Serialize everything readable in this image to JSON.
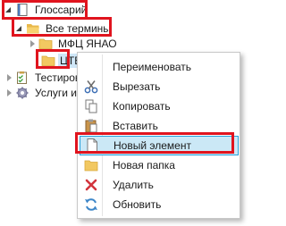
{
  "tree": {
    "root": {
      "label": "Глоссарий",
      "icon": "book-icon"
    },
    "all_terms": {
      "label": "Все термины",
      "icon": "open-folder-icon"
    },
    "children": [
      {
        "label": "МФЦ ЯНАО",
        "icon": "folder-icon"
      },
      {
        "label": "ЦТБ",
        "icon": "folder-icon"
      }
    ],
    "siblings": [
      {
        "label": "Тестиров",
        "icon": "clipboard-checklist-icon"
      },
      {
        "label": "Услуги и",
        "icon": "gear-icon"
      }
    ]
  },
  "context_menu": {
    "items": [
      {
        "label": "Переименовать",
        "icon": "none"
      },
      {
        "label": "Вырезать",
        "icon": "scissors-icon"
      },
      {
        "label": "Копировать",
        "icon": "copy-icon"
      },
      {
        "label": "Вставить",
        "icon": "paste-icon"
      },
      {
        "label": "Новый элемент",
        "icon": "new-document-icon",
        "highlighted": true
      },
      {
        "label": "Новая папка",
        "icon": "folder-icon"
      },
      {
        "label": "Удалить",
        "icon": "delete-x-icon"
      },
      {
        "label": "Обновить",
        "icon": "refresh-icon"
      }
    ]
  },
  "colors": {
    "annotation_red": "#e0141e",
    "folder_yellow": "#f2c861",
    "menu_highlight": "#cbe8f6",
    "menu_highlight_border": "#26a0da"
  }
}
